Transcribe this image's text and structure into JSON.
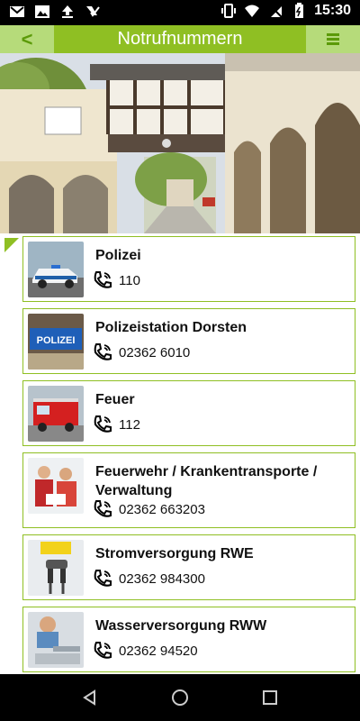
{
  "status_bar": {
    "time": "15:30",
    "icons": [
      "gmail-icon",
      "image-icon",
      "upload-icon",
      "check-flag-icon",
      "vibrate-icon",
      "wifi-icon",
      "no-sim-icon",
      "battery-charging-icon"
    ]
  },
  "app_bar": {
    "back_label": "<",
    "title": "Notrufnummern",
    "menu_icon": "hamburger-menu-icon"
  },
  "hero": {
    "image": "town-hall-courtyard-photo"
  },
  "contacts": [
    {
      "name": "Polizei",
      "phone": "110",
      "thumb": "police-car-photo"
    },
    {
      "name": "Polizeistation Dorsten",
      "phone": "02362 6010",
      "thumb": "polizei-sign-photo"
    },
    {
      "name": "Feuer",
      "phone": "112",
      "thumb": "fire-truck-photo"
    },
    {
      "name": "Feuerwehr / Krankentransporte / Verwaltung",
      "name_line1": "Feuerwehr / Krankentransporte /",
      "name_line2": "Verwaltung",
      "phone": "02362 663203",
      "thumb": "paramedics-photo"
    },
    {
      "name": "Stromversorgung RWE",
      "phone": "02362 984300",
      "thumb": "power-plug-out-of-order-photo"
    },
    {
      "name": "Wasserversorgung RWW",
      "phone": "02362 94520",
      "thumb": "water-tap-photo"
    }
  ],
  "colors": {
    "accent": "#8fbf23",
    "accent_light": "#b6db7a",
    "accent_dark": "#5b9a08"
  },
  "system_nav": [
    "back-triangle-icon",
    "home-circle-icon",
    "recents-square-icon"
  ]
}
